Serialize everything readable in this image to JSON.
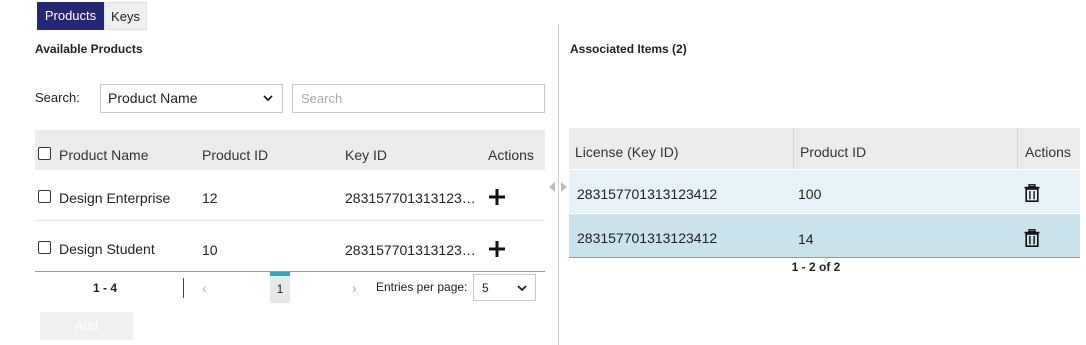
{
  "tabs": [
    {
      "label": "Products",
      "active": true
    },
    {
      "label": "Keys",
      "active": false
    }
  ],
  "left": {
    "title": "Available Products",
    "search_label": "Search:",
    "search_field_selected": "Product Name",
    "search_placeholder": "Search",
    "columns": [
      "Product Name",
      "Product ID",
      "Key ID",
      "Actions"
    ],
    "rows": [
      {
        "name": "Design Enterprise",
        "product_id": "12",
        "key_id": "283157701313123…"
      },
      {
        "name": "Design Student",
        "product_id": "10",
        "key_id": "283157701313123…"
      }
    ],
    "pager": {
      "range": "1 - 4",
      "prev": "‹",
      "current_page": "1",
      "next": "›",
      "entries_label": "Entries per page:",
      "entries_value": "5"
    },
    "add_label": "Add"
  },
  "right": {
    "title": "Associated Items (2)",
    "columns": [
      "License (Key ID)",
      "Product ID",
      "Actions"
    ],
    "rows": [
      {
        "license": "283157701313123412",
        "product_id": "100"
      },
      {
        "license": "283157701313123412",
        "product_id": "14"
      }
    ],
    "range": "1 - 2 of 2"
  },
  "colors": {
    "accent": "#262677",
    "pager_marker": "#2aa8c4",
    "row_light": "#e6f2f8",
    "row_selected": "#c9e2ec"
  }
}
